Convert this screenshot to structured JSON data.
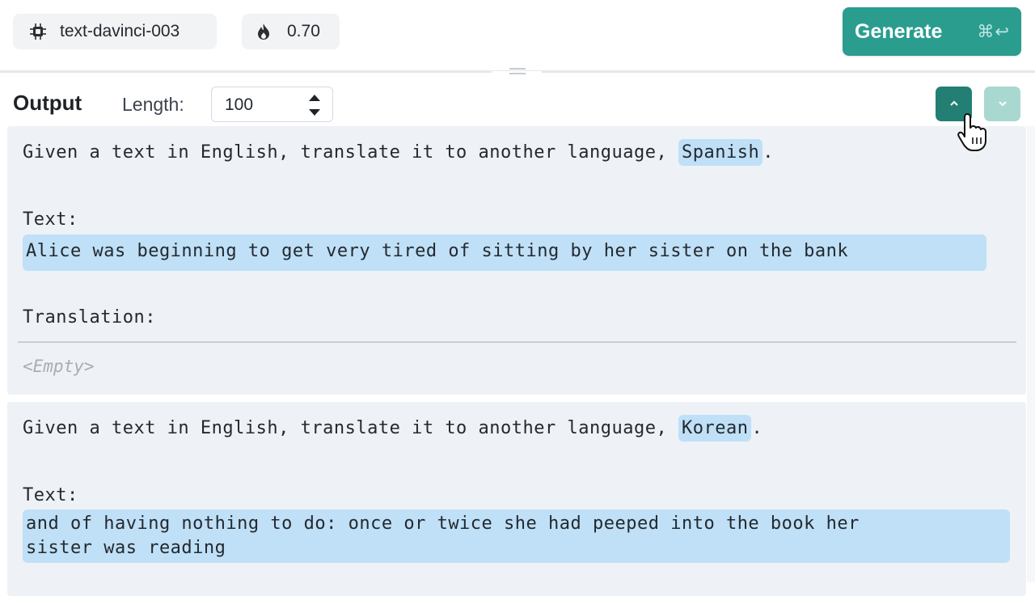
{
  "toolbar": {
    "model": {
      "label": "text-davinci-003",
      "icon": "chip-icon"
    },
    "temperature": {
      "label": "0.70",
      "icon": "flame-icon"
    },
    "generate": {
      "label": "Generate",
      "shortcut": "⌘↩",
      "color": "#2a9d8f"
    }
  },
  "output": {
    "title": "Output",
    "length_label": "Length:",
    "length_value": "100",
    "nav_up_icon": "chevron-up-icon",
    "nav_down_icon": "chevron-down-icon"
  },
  "items": [
    {
      "instruction_prefix": "Given a text in English, translate it to another language, ",
      "language": "Spanish",
      "instruction_suffix": ".",
      "text_label": "Text:",
      "text_lines": [
        "Alice was beginning to get very tired of sitting by her sister on the bank"
      ],
      "translation_label": "Translation:",
      "result": "<Empty>"
    },
    {
      "instruction_prefix": "Given a text in English, translate it to another language, ",
      "language": "Korean",
      "instruction_suffix": ".",
      "text_label": "Text:",
      "text_lines": [
        "and of having nothing to do: once or twice she had peeped into the book her",
        "sister was reading"
      ]
    }
  ],
  "colors": {
    "accent": "#2a9d8f",
    "accent_dark": "#237f74",
    "highlight": "#bfe0f7",
    "panel_bg": "#eef1f6"
  }
}
